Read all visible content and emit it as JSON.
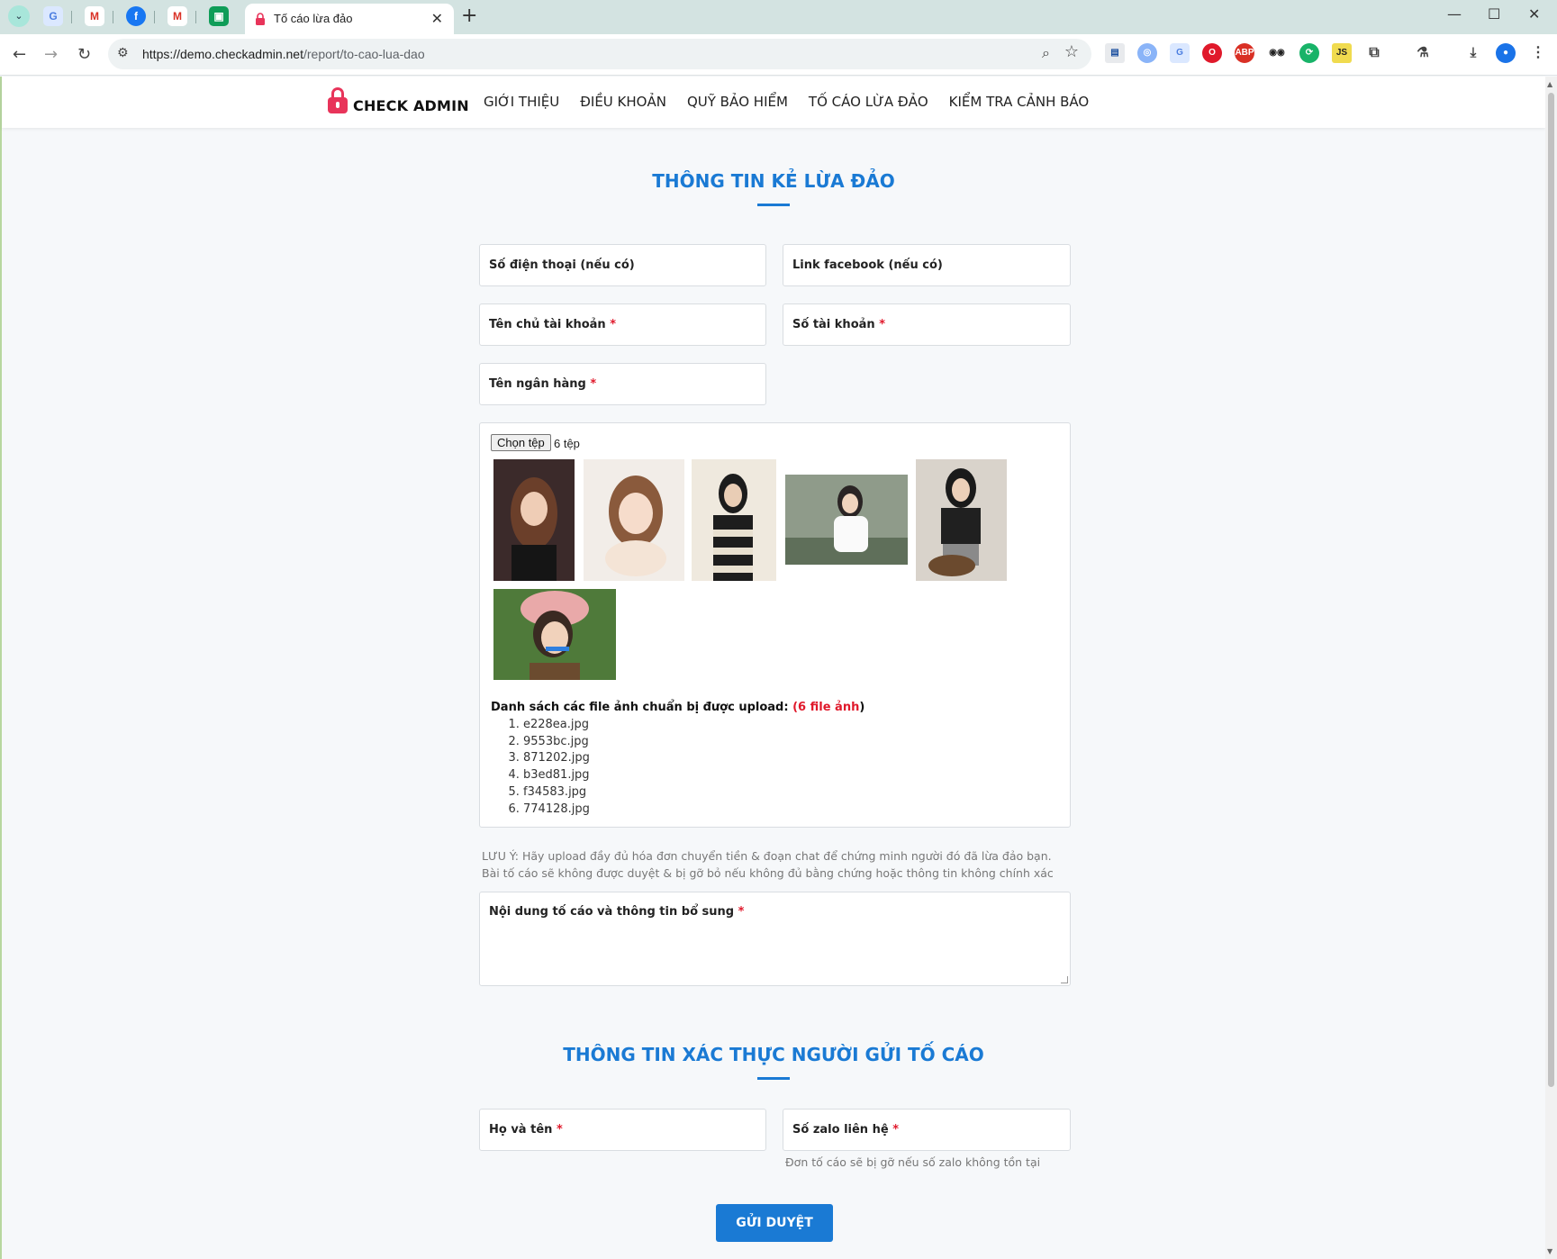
{
  "browser": {
    "tab_title": "Tố cáo lừa đảo",
    "url_host": "https://demo.checkadmin.net",
    "url_path": "/report/to-cao-lua-dao"
  },
  "site": {
    "logo_text": "CHECK ADMIN",
    "menu": [
      "GIỚI THIỆU",
      "ĐIỀU KHOẢN",
      "QUỸ BẢO HIỂM",
      "TỐ CÁO LỪA ĐẢO",
      "KIỂM TRA CẢNH BÁO"
    ]
  },
  "scammer_section": {
    "title": "THÔNG TIN KẺ LỪA ĐẢO",
    "phone_label": "Số điện thoại (nếu có)",
    "facebook_label": "Link facebook (nếu có)",
    "account_owner_label": "Tên chủ tài khoản",
    "account_number_label": "Số tài khoản",
    "bank_name_label": "Tên ngân hàng",
    "required_mark": "*"
  },
  "upload": {
    "button_label": "Chọn tệp",
    "file_count_text": "6 tệp",
    "list_heading": "Danh sách các file ảnh chuẩn bị được upload:",
    "list_count_open": "(",
    "list_count": "6 file ảnh",
    "list_count_close": ")",
    "files": [
      "e228ea.jpg",
      "9553bc.jpg",
      "871202.jpg",
      "b3ed81.jpg",
      "f34583.jpg",
      "774128.jpg"
    ]
  },
  "note": "LƯU Ý: Hãy upload đầy đủ hóa đơn chuyển tiền & đoạn chat để chứng minh người đó đã lừa đảo bạn. Bài tố cáo sẽ không được duyệt & bị gỡ bỏ nếu không đủ bằng chứng hoặc thông tin không chính xác",
  "content_label": "Nội dung tố cáo và thông tin bổ sung",
  "sender_section": {
    "title": "THÔNG TIN XÁC THỰC NGƯỜI GỬI TỐ CÁO",
    "fullname_label": "Họ và tên",
    "zalo_label": "Số zalo liên hệ",
    "zalo_hint": "Đơn tố cáo sẽ bị gỡ nếu số zalo không tồn tại"
  },
  "submit_label": "GỬI DUYỆT",
  "colors": {
    "accent": "#1a7ad4",
    "required": "#e0192b",
    "logo": "#e8345a"
  }
}
